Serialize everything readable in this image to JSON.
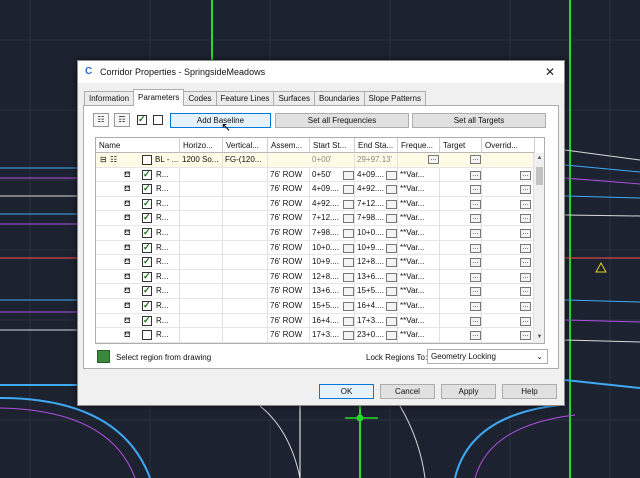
{
  "window": {
    "title": "Corridor Properties - SpringsideMeadows",
    "close_glyph": "✕"
  },
  "tabs": [
    {
      "label": "Information",
      "active": false
    },
    {
      "label": "Parameters",
      "active": true
    },
    {
      "label": "Codes",
      "active": false
    },
    {
      "label": "Feature Lines",
      "active": false
    },
    {
      "label": "Surfaces",
      "active": false
    },
    {
      "label": "Boundaries",
      "active": false
    },
    {
      "label": "Slope Patterns",
      "active": false
    }
  ],
  "toolbar": {
    "add_baseline": "Add Baseline",
    "set_all_frequencies": "Set all Frequencies",
    "set_all_targets": "Set all Targets"
  },
  "grid": {
    "headers": [
      "Name",
      "Horizo...",
      "Vertical...",
      "Assem...",
      "Start St...",
      "End Sta...",
      "Freque...",
      "Target",
      "Overrid..."
    ],
    "baseline_row": {
      "name": "BL - ...",
      "horizontal": "1200 So...",
      "vertical": "FG-(120...",
      "start": "0+00'",
      "end": "29+97.13'"
    },
    "rows": [
      {
        "name": "R...",
        "assembly": "76' ROW",
        "start": "0+50'",
        "end": "4+09....",
        "frequency": "**Var...",
        "checked": true
      },
      {
        "name": "R...",
        "assembly": "76' ROW",
        "start": "4+09....",
        "end": "4+92....",
        "frequency": "**Var...",
        "checked": true
      },
      {
        "name": "R...",
        "assembly": "76' ROW",
        "start": "4+92....",
        "end": "7+12....",
        "frequency": "**Var...",
        "checked": true
      },
      {
        "name": "R...",
        "assembly": "76' ROW",
        "start": "7+12....",
        "end": "7+98....",
        "frequency": "**Var...",
        "checked": true
      },
      {
        "name": "R...",
        "assembly": "76' ROW",
        "start": "7+98....",
        "end": "10+0....",
        "frequency": "**Var...",
        "checked": true
      },
      {
        "name": "R...",
        "assembly": "76' ROW",
        "start": "10+0....",
        "end": "10+9....",
        "frequency": "**Var...",
        "checked": true
      },
      {
        "name": "R...",
        "assembly": "76' ROW",
        "start": "10+9....",
        "end": "12+8....",
        "frequency": "**Var...",
        "checked": true
      },
      {
        "name": "R...",
        "assembly": "76' ROW",
        "start": "12+8....",
        "end": "13+6....",
        "frequency": "**Var...",
        "checked": true
      },
      {
        "name": "R...",
        "assembly": "76' ROW",
        "start": "13+6....",
        "end": "15+5....",
        "frequency": "**Var...",
        "checked": true
      },
      {
        "name": "R...",
        "assembly": "76' ROW",
        "start": "15+5....",
        "end": "16+4....",
        "frequency": "**Var...",
        "checked": true
      },
      {
        "name": "R...",
        "assembly": "76' ROW",
        "start": "16+4....",
        "end": "17+3....",
        "frequency": "**Var...",
        "checked": true
      },
      {
        "name": "R...",
        "assembly": "76' ROW",
        "start": "17+3....",
        "end": "23+0....",
        "frequency": "**Var...",
        "checked": false
      },
      {
        "name": "R...",
        "assembly": "76' ROW",
        "start": "23+0....",
        "end": "",
        "frequency": "",
        "checked": false
      }
    ]
  },
  "bottom": {
    "select_region": "Select region from drawing",
    "lock_regions_label": "Lock Regions To:",
    "lock_regions_value": "Geometry Locking"
  },
  "buttons": {
    "ok": "OK",
    "cancel": "Cancel",
    "apply": "Apply",
    "help": "Help"
  },
  "colors": {
    "cad_background": "#1d2230",
    "accent_blue": "#0078d7"
  }
}
